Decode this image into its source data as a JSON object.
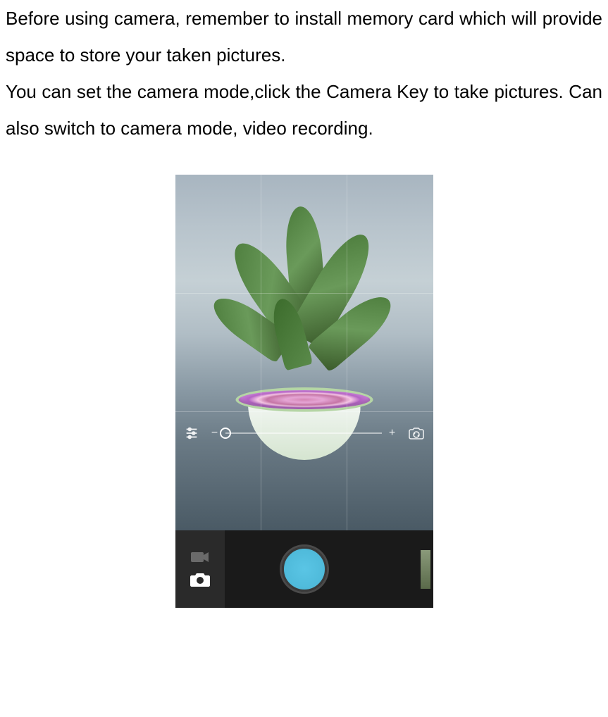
{
  "document": {
    "paragraph1": "Before using camera, remember to install memory card which will provide space to store your taken pictures.",
    "paragraph2": "You can set the camera mode,click the Camera Key to take pictures. Can also switch to camera mode, video recording."
  },
  "camera_ui": {
    "zoom_minus": "−",
    "zoom_plus": "+"
  }
}
